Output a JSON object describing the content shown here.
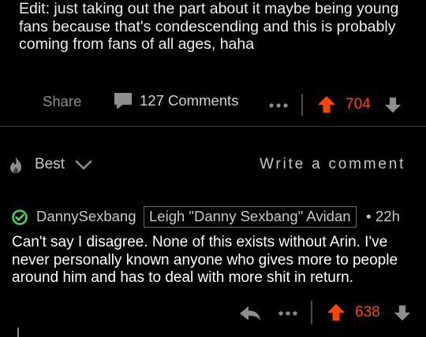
{
  "post": {
    "edit_text": "Edit: just taking out the part about it maybe being young fans because that's condescending and this is probably coming from fans of all ages, haha"
  },
  "post_actions": {
    "share_label": "Share",
    "comments_label": "127 Comments",
    "score": "704",
    "icons": [
      "comment-icon",
      "more-icon",
      "upvote-icon",
      "downvote-icon"
    ]
  },
  "sort": {
    "label": "Best",
    "icon": "flame-icon",
    "write_comment_placeholder": "Write a comment"
  },
  "comment": {
    "username": "DannySexbang",
    "flair": "Leigh \"Danny Sexbang\" Avidan",
    "separator": "•",
    "time": "22h",
    "body": "Can't say I disagree. None of this exists without Arin. I've never personally known anyone who gives more to people around him and has to deal with more shit in return.",
    "score": "638"
  },
  "colors": {
    "background": "#000000",
    "upvote": "#ff4500",
    "verified": "#46d160",
    "muted_text": "#8e8e8e",
    "text": "#ffffff"
  }
}
